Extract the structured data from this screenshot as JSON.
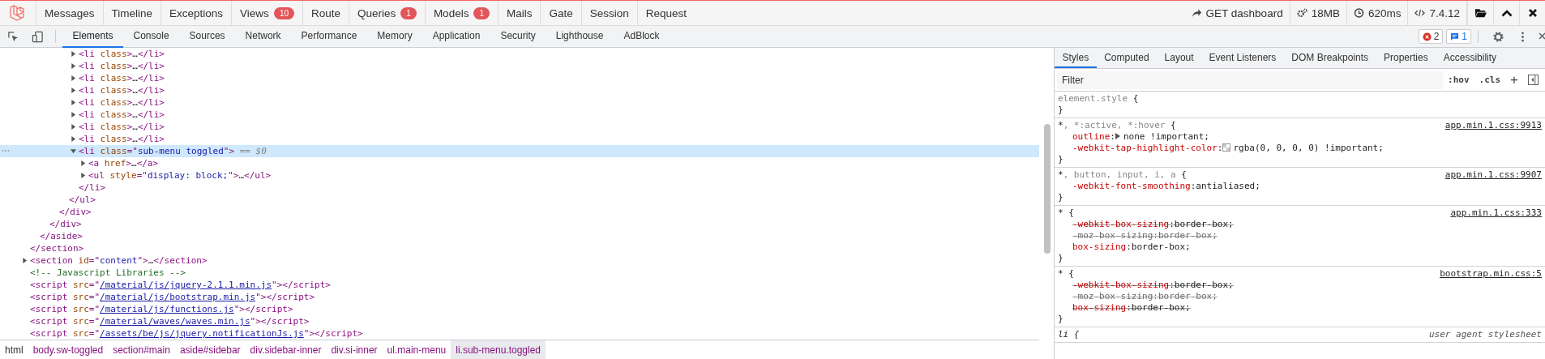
{
  "debugbar": {
    "tabs": [
      {
        "label": "Messages"
      },
      {
        "label": "Timeline"
      },
      {
        "label": "Exceptions"
      },
      {
        "label": "Views",
        "badge": "10"
      },
      {
        "label": "Route"
      },
      {
        "label": "Queries",
        "badge": "1"
      },
      {
        "label": "Models",
        "badge": "1"
      },
      {
        "label": "Mails"
      },
      {
        "label": "Gate"
      },
      {
        "label": "Session"
      },
      {
        "label": "Request"
      }
    ],
    "status": [
      {
        "kind": "route",
        "text": "GET dashboard"
      },
      {
        "kind": "memory",
        "text": "18MB"
      },
      {
        "kind": "time",
        "text": "620ms"
      },
      {
        "kind": "php",
        "text": "7.4.12"
      }
    ]
  },
  "devtools": {
    "tabs": [
      {
        "label": "Elements",
        "selected": true
      },
      {
        "label": "Console",
        "selected": false
      },
      {
        "label": "Sources",
        "selected": false
      },
      {
        "label": "Network",
        "selected": false
      },
      {
        "label": "Performance",
        "selected": false
      },
      {
        "label": "Memory",
        "selected": false
      },
      {
        "label": "Application",
        "selected": false
      },
      {
        "label": "Security",
        "selected": false
      },
      {
        "label": "Lighthouse",
        "selected": false
      },
      {
        "label": "AdBlock",
        "selected": false
      }
    ],
    "errors": "2",
    "messages": "1"
  },
  "dom_tree": [
    {
      "close": [
        {
          "kind": "tag",
          "text": "</section>"
        }
      ],
      "children": [
        {
          "close": [
            {
              "kind": "tag",
              "text": "</aside>"
            }
          ],
          "children": [
            {
              "close": [
                {
                  "kind": "tag",
                  "text": "</div>"
                }
              ],
              "children": [
                {
                  "close": [
                    {
                      "kind": "tag",
                      "text": "</div>"
                    }
                  ],
                  "children": [
                    {
                      "close": [
                        {
                          "kind": "tag",
                          "text": "</ul>"
                        }
                      ],
                      "children": [
                        {
                          "open": [
                            {
                              "kind": "tag",
                              "text": "<li"
                            },
                            {
                              "kind": "attr",
                              "text": " class"
                            },
                            {
                              "kind": "tag",
                              "text": ">"
                            },
                            {
                              "kind": "text",
                              "text": "…"
                            },
                            {
                              "kind": "tag",
                              "text": "</li>"
                            }
                          ],
                          "expanded": false,
                          "selected": false
                        },
                        {
                          "open": [
                            {
                              "kind": "tag",
                              "text": "<li"
                            },
                            {
                              "kind": "attr",
                              "text": " class"
                            },
                            {
                              "kind": "tag",
                              "text": ">"
                            },
                            {
                              "kind": "text",
                              "text": "…"
                            },
                            {
                              "kind": "tag",
                              "text": "</li>"
                            }
                          ],
                          "expanded": false,
                          "selected": false
                        },
                        {
                          "open": [
                            {
                              "kind": "tag",
                              "text": "<li"
                            },
                            {
                              "kind": "attr",
                              "text": " class"
                            },
                            {
                              "kind": "tag",
                              "text": ">"
                            },
                            {
                              "kind": "text",
                              "text": "…"
                            },
                            {
                              "kind": "tag",
                              "text": "</li>"
                            }
                          ],
                          "expanded": false,
                          "selected": false
                        },
                        {
                          "open": [
                            {
                              "kind": "tag",
                              "text": "<li"
                            },
                            {
                              "kind": "attr",
                              "text": " class"
                            },
                            {
                              "kind": "tag",
                              "text": ">"
                            },
                            {
                              "kind": "text",
                              "text": "…"
                            },
                            {
                              "kind": "tag",
                              "text": "</li>"
                            }
                          ],
                          "expanded": false,
                          "selected": false
                        },
                        {
                          "open": [
                            {
                              "kind": "tag",
                              "text": "<li"
                            },
                            {
                              "kind": "attr",
                              "text": " class"
                            },
                            {
                              "kind": "tag",
                              "text": ">"
                            },
                            {
                              "kind": "text",
                              "text": "…"
                            },
                            {
                              "kind": "tag",
                              "text": "</li>"
                            }
                          ],
                          "expanded": false,
                          "selected": false
                        },
                        {
                          "open": [
                            {
                              "kind": "tag",
                              "text": "<li"
                            },
                            {
                              "kind": "attr",
                              "text": " class"
                            },
                            {
                              "kind": "tag",
                              "text": ">"
                            },
                            {
                              "kind": "text",
                              "text": "…"
                            },
                            {
                              "kind": "tag",
                              "text": "</li>"
                            }
                          ],
                          "expanded": false,
                          "selected": false
                        },
                        {
                          "open": [
                            {
                              "kind": "tag",
                              "text": "<li"
                            },
                            {
                              "kind": "attr",
                              "text": " class"
                            },
                            {
                              "kind": "tag",
                              "text": ">"
                            },
                            {
                              "kind": "text",
                              "text": "…"
                            },
                            {
                              "kind": "tag",
                              "text": "</li>"
                            }
                          ],
                          "expanded": false,
                          "selected": false
                        },
                        {
                          "open": [
                            {
                              "kind": "tag",
                              "text": "<li"
                            },
                            {
                              "kind": "attr",
                              "text": " class"
                            },
                            {
                              "kind": "tag",
                              "text": ">"
                            },
                            {
                              "kind": "text",
                              "text": "…"
                            },
                            {
                              "kind": "tag",
                              "text": "</li>"
                            }
                          ],
                          "expanded": false,
                          "selected": false
                        },
                        {
                          "open": [
                            {
                              "kind": "tag",
                              "text": "<li"
                            },
                            {
                              "kind": "attr",
                              "text": " class"
                            },
                            {
                              "kind": "tag",
                              "text": "=\""
                            },
                            {
                              "kind": "value",
                              "text": "sub-menu toggled"
                            },
                            {
                              "kind": "tag",
                              "text": "\">"
                            },
                            {
                              "kind": "marker",
                              "text": " == $0"
                            }
                          ],
                          "expanded": true,
                          "selected": true,
                          "close": [
                            {
                              "kind": "tag",
                              "text": "</li>"
                            }
                          ],
                          "children": [
                            {
                              "open": [
                                {
                                  "kind": "tag",
                                  "text": "<a"
                                },
                                {
                                  "kind": "attr",
                                  "text": " href"
                                },
                                {
                                  "kind": "tag",
                                  "text": ">"
                                },
                                {
                                  "kind": "text",
                                  "text": "…"
                                },
                                {
                                  "kind": "tag",
                                  "text": "</a>"
                                }
                              ],
                              "expanded": false,
                              "selected": false
                            },
                            {
                              "open": [
                                {
                                  "kind": "tag",
                                  "text": "<ul"
                                },
                                {
                                  "kind": "attr",
                                  "text": " style"
                                },
                                {
                                  "kind": "tag",
                                  "text": "=\""
                                },
                                {
                                  "kind": "value",
                                  "text": "display: block;"
                                },
                                {
                                  "kind": "tag",
                                  "text": "\">"
                                },
                                {
                                  "kind": "text",
                                  "text": "…"
                                },
                                {
                                  "kind": "tag",
                                  "text": "</ul>"
                                }
                              ],
                              "expanded": false,
                              "selected": false
                            }
                          ]
                        }
                      ]
                    }
                  ]
                }
              ]
            }
          ]
        }
      ]
    },
    {
      "open": [
        {
          "kind": "tag",
          "text": "<section"
        },
        {
          "kind": "attr",
          "text": " id"
        },
        {
          "kind": "tag",
          "text": "=\""
        },
        {
          "kind": "value",
          "text": "content"
        },
        {
          "kind": "tag",
          "text": "\">"
        },
        {
          "kind": "text",
          "text": "…"
        },
        {
          "kind": "tag",
          "text": "</section>"
        }
      ],
      "expanded": false,
      "selected": false
    },
    {
      "open": [
        {
          "kind": "comment",
          "text": "<!-- Javascript Libraries -->"
        }
      ],
      "selected": false
    },
    {
      "open": [
        {
          "kind": "tag",
          "text": "<script"
        },
        {
          "kind": "attr",
          "text": " src"
        },
        {
          "kind": "tag",
          "text": "=\""
        },
        {
          "kind": "link",
          "text": "/material/js/jquery-2.1.1.min.js"
        },
        {
          "kind": "tag",
          "text": "\"></script>"
        }
      ],
      "selected": false
    },
    {
      "open": [
        {
          "kind": "tag",
          "text": "<script"
        },
        {
          "kind": "attr",
          "text": " src"
        },
        {
          "kind": "tag",
          "text": "=\""
        },
        {
          "kind": "link",
          "text": "/material/js/bootstrap.min.js"
        },
        {
          "kind": "tag",
          "text": "\"></script>"
        }
      ],
      "selected": false
    },
    {
      "open": [
        {
          "kind": "tag",
          "text": "<script"
        },
        {
          "kind": "attr",
          "text": " src"
        },
        {
          "kind": "tag",
          "text": "=\""
        },
        {
          "kind": "link",
          "text": "/material/js/functions.js"
        },
        {
          "kind": "tag",
          "text": "\"></script>"
        }
      ],
      "selected": false
    },
    {
      "open": [
        {
          "kind": "tag",
          "text": "<script"
        },
        {
          "kind": "attr",
          "text": " src"
        },
        {
          "kind": "tag",
          "text": "=\""
        },
        {
          "kind": "link",
          "text": "/material/waves/waves.min.js"
        },
        {
          "kind": "tag",
          "text": "\"></script>"
        }
      ],
      "selected": false
    },
    {
      "open": [
        {
          "kind": "tag",
          "text": "<script"
        },
        {
          "kind": "attr",
          "text": " src"
        },
        {
          "kind": "tag",
          "text": "=\""
        },
        {
          "kind": "link",
          "text": "/assets/be/js/jquery.notificationJs.js"
        },
        {
          "kind": "tag",
          "text": "\"></script>"
        }
      ],
      "selected": false
    }
  ],
  "breadcrumbs": [
    {
      "label": "html",
      "selected": false
    },
    {
      "label": "body.sw-toggled",
      "selected": false
    },
    {
      "label": "section#main",
      "selected": false
    },
    {
      "label": "aside#sidebar",
      "selected": false
    },
    {
      "label": "div.sidebar-inner",
      "selected": false
    },
    {
      "label": "div.si-inner",
      "selected": false
    },
    {
      "label": "ul.main-menu",
      "selected": false
    },
    {
      "label": "li.sub-menu.toggled",
      "selected": true
    }
  ],
  "styles": {
    "tabs": [
      {
        "label": "Styles",
        "selected": true
      },
      {
        "label": "Computed",
        "selected": false
      },
      {
        "label": "Layout",
        "selected": false
      },
      {
        "label": "Event Listeners",
        "selected": false
      },
      {
        "label": "DOM Breakpoints",
        "selected": false
      },
      {
        "label": "Properties",
        "selected": false
      },
      {
        "label": "Accessibility",
        "selected": false
      }
    ],
    "filter": {
      "placeholder": "Filter"
    },
    "hov": ":hov",
    "cls": ".cls",
    "add": "+",
    "rules": [
      {
        "kind": "inline",
        "others": "element.style",
        "open": " {",
        "close": "}"
      },
      {
        "kind": "link",
        "selector": "*",
        "others": ", *:active, *:hover",
        "open": " {",
        "source": "app.min.1.css:9913",
        "close": "}",
        "declarations": [
          {
            "prop": "outline",
            "sep": ":",
            "value": "none !important;",
            "struck": false,
            "invalid": false,
            "arrow": true,
            "swatch": false
          },
          {
            "prop": "-webkit-tap-highlight-color",
            "sep": ":",
            "value": "rgba(0, 0, 0, 0) !important;",
            "struck": false,
            "invalid": false,
            "arrow": false,
            "swatch": true
          }
        ]
      },
      {
        "kind": "link",
        "selector": "*",
        "others": ", button, input, i, a",
        "open": " {",
        "source": "app.min.1.css:9907",
        "close": "}",
        "declarations": [
          {
            "prop": "-webkit-font-smoothing",
            "sep": ":",
            "value": "antialiased;",
            "struck": false,
            "invalid": false,
            "arrow": false,
            "swatch": false
          }
        ]
      },
      {
        "kind": "link",
        "selector": "*",
        "open": " {",
        "source": "app.min.1.css:333",
        "close": "}",
        "declarations": [
          {
            "prop": "-webkit-box-sizing",
            "sep": ":",
            "value": "border-box;",
            "struck": true,
            "invalid": false,
            "arrow": false,
            "swatch": false
          },
          {
            "prop": "-moz-box-sizing",
            "sep": ":",
            "value": "border-box;",
            "struck": true,
            "invalid": true,
            "arrow": false,
            "swatch": false
          },
          {
            "prop": "box-sizing",
            "sep": ":",
            "value": "border-box;",
            "struck": false,
            "invalid": false,
            "arrow": false,
            "swatch": false
          }
        ]
      },
      {
        "kind": "link",
        "selector": "*",
        "open": " {",
        "source": "bootstrap.min.css:5",
        "close": "}",
        "declarations": [
          {
            "prop": "-webkit-box-sizing",
            "sep": ":",
            "value": "border-box;",
            "struck": true,
            "invalid": false,
            "arrow": false,
            "swatch": false
          },
          {
            "prop": "-moz-box-sizing",
            "sep": ":",
            "value": "border-box;",
            "struck": true,
            "invalid": true,
            "arrow": false,
            "swatch": false
          },
          {
            "prop": "box-sizing",
            "sep": ":",
            "value": "border-box;",
            "struck": true,
            "invalid": false,
            "arrow": false,
            "swatch": false
          }
        ]
      },
      {
        "kind": "agent",
        "selector": "li",
        "open": " {",
        "source": "user agent stylesheet"
      }
    ]
  }
}
